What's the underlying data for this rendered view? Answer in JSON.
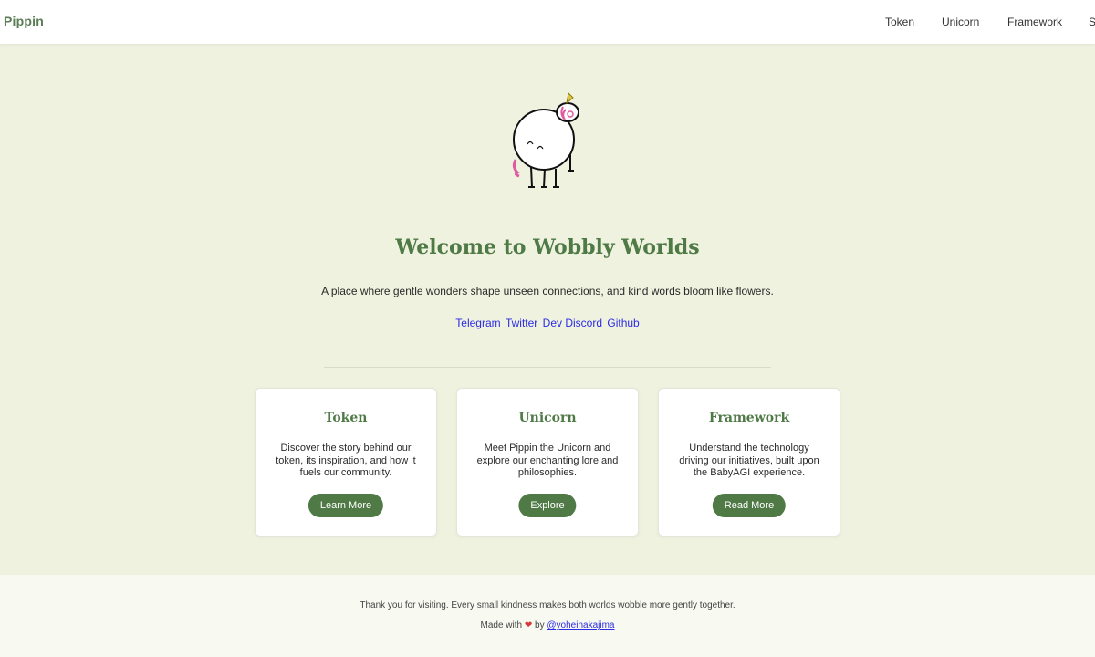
{
  "header": {
    "brand": "Pippin",
    "nav": [
      {
        "label": "Token"
      },
      {
        "label": "Unicorn"
      },
      {
        "label": "Framework"
      },
      {
        "label": "S"
      }
    ]
  },
  "hero": {
    "title": "Welcome to Wobbly Worlds",
    "tagline": "A place where gentle wonders shape unseen connections, and kind words bloom like flowers.",
    "links": [
      {
        "label": "Telegram"
      },
      {
        "label": "Twitter"
      },
      {
        "label": "Dev Discord"
      },
      {
        "label": "Github"
      }
    ]
  },
  "cards": [
    {
      "title": "Token",
      "text": "Discover the story behind our token, its inspiration, and how it fuels our community.",
      "button": "Learn More"
    },
    {
      "title": "Unicorn",
      "text": "Meet Pippin the Unicorn and explore our enchanting lore and philosophies.",
      "button": "Explore"
    },
    {
      "title": "Framework",
      "text": "Understand the technology driving our initiatives, built upon the BabyAGI experience.",
      "button": "Read More"
    }
  ],
  "footer": {
    "note": "Thank you for visiting. Every small kindness makes both worlds wobble more gently together.",
    "made_prefix": "Made with",
    "heart": "❤",
    "made_by": "by",
    "author": "@yoheinakajima"
  },
  "colors": {
    "accent": "#4f7a46",
    "background": "#eff2df",
    "link": "#2b2be6"
  }
}
